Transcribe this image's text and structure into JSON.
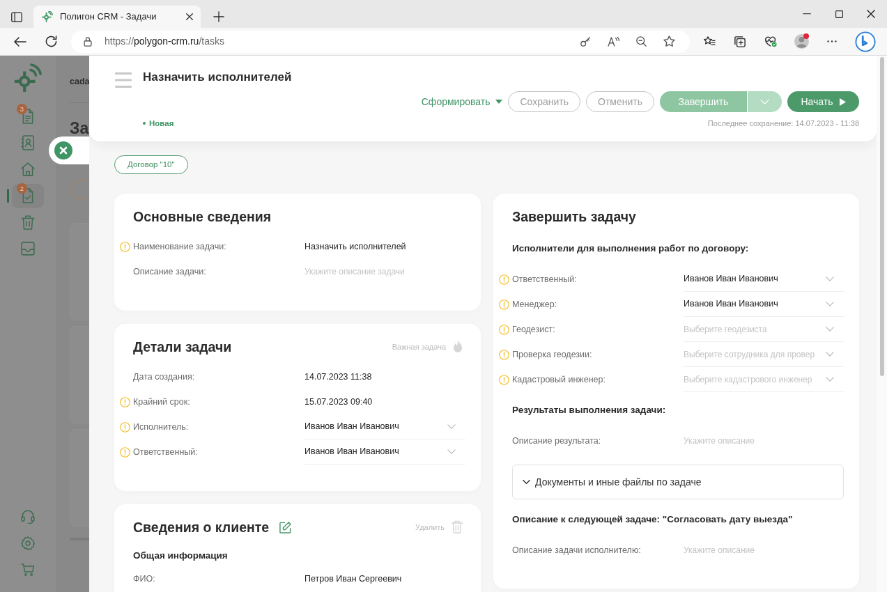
{
  "browser": {
    "tab_title": "Полигон CRM - Задачи",
    "url": {
      "scheme": "https://",
      "host": "polygon-crm.ru",
      "path": "/tasks"
    },
    "profile_alert": true
  },
  "app_sidebar": {
    "items": [
      {
        "badge": "3",
        "selected": false
      },
      {
        "selected": false
      },
      {
        "selected": false
      },
      {
        "badge": "2",
        "selected": true
      },
      {
        "selected": false
      },
      {
        "selected": false
      }
    ]
  },
  "background_page": {
    "breadcrumb": "cada",
    "title": "За"
  },
  "drawer": {
    "header": {
      "title": "Назначить исполнителей",
      "actions": [
        {
          "kind": "dropdown-link",
          "label": "Сформировать"
        },
        {
          "kind": "outline",
          "label": "Сохранить"
        },
        {
          "kind": "outline",
          "label": "Отменить"
        },
        {
          "kind": "split",
          "label": "Завершить"
        },
        {
          "kind": "primary",
          "label": "Начать"
        }
      ],
      "status": "Новая",
      "last_saved": "Последнее сохранение: 14.07.2023 - 11:38"
    },
    "chip": "Договор \"10\"",
    "left_cards": [
      {
        "title": "Основные сведения",
        "blocks": [
          {
            "kind": "value",
            "label": "Наименование задачи:",
            "required": true,
            "value": "Назначить исполнителей"
          },
          {
            "kind": "input",
            "label": "Описание задачи:",
            "required": false,
            "placeholder": "Укажите описание задачи"
          }
        ]
      },
      {
        "title": "Детали задачи",
        "important": {
          "label": "Важная задача",
          "on": false
        },
        "blocks": [
          {
            "kind": "value",
            "label": "Дата создания:",
            "required": false,
            "value": "14.07.2023 11:38"
          },
          {
            "kind": "value",
            "label": "Крайний срок:",
            "required": true,
            "value": "15.07.2023 09:40"
          },
          {
            "kind": "select",
            "label": "Исполнитель:",
            "required": true,
            "value": "Иванов Иван Иванович"
          },
          {
            "kind": "select",
            "label": "Ответственный:",
            "required": true,
            "value": "Иванов Иван Иванович"
          }
        ]
      },
      {
        "title": "Сведения о клиенте",
        "editable": true,
        "delete_label": "Удалить",
        "blocks": [
          {
            "kind": "heading",
            "text": "Общая информация"
          },
          {
            "kind": "value",
            "label": "ФИО:",
            "required": false,
            "value": "Петров Иван Сергеевич"
          }
        ]
      }
    ],
    "right_card": {
      "title": "Завершить задачу",
      "blocks": [
        {
          "kind": "heading",
          "text": "Исполнители для выполнения работ по договору:"
        },
        {
          "kind": "select",
          "label": "Ответственный:",
          "required": true,
          "value": "Иванов Иван Иванович"
        },
        {
          "kind": "select",
          "label": "Менеджер:",
          "required": true,
          "value": "Иванов Иван Иванович"
        },
        {
          "kind": "select",
          "label": "Геодезист:",
          "required": true,
          "placeholder": "Выберите геодезиста"
        },
        {
          "kind": "select",
          "label": "Проверка геодезии:",
          "required": true,
          "placeholder": "Выберите сотрудника для провер"
        },
        {
          "kind": "select",
          "label": "Кадастровый инженер:",
          "required": true,
          "placeholder": "Выберите кадастрового инженер"
        },
        {
          "kind": "heading",
          "text": "Результаты выполнения задачи:"
        },
        {
          "kind": "input",
          "label": "Описание результата:",
          "required": false,
          "placeholder": "Укажите описание"
        },
        {
          "kind": "accordion",
          "label": "Документы и иные файлы по задаче",
          "expanded": false
        },
        {
          "kind": "heading",
          "text": "Описание к следующей задаче: \"Согласовать дату выезда\""
        },
        {
          "kind": "input",
          "label": "Описание задачи исполнителю:",
          "required": false,
          "placeholder": "Укажите описание"
        }
      ]
    }
  }
}
